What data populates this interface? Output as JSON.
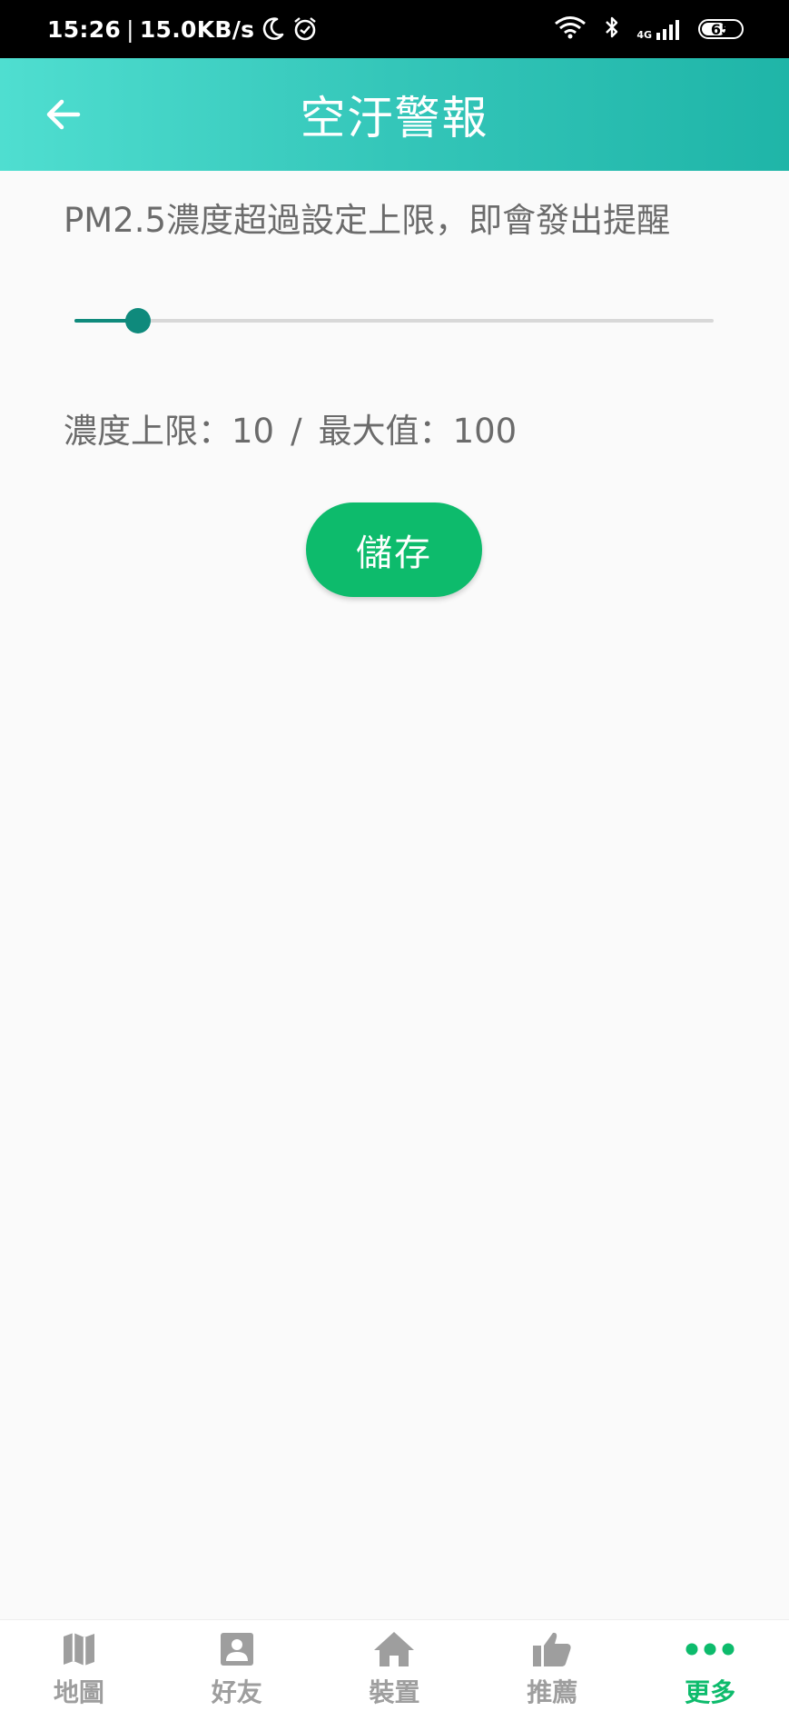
{
  "status_bar": {
    "time": "15:26",
    "speed": "15.0KB/s",
    "battery": "65",
    "battery_level": 0.65,
    "network": "4G"
  },
  "app_bar": {
    "title": "空汙警報"
  },
  "content": {
    "description": "PM2.5濃度超過設定上限，即會發出提醒",
    "limit_label": "濃度上限：",
    "limit_value": "10",
    "separator": "/",
    "max_label": "最大值：",
    "max_value": "100",
    "slider": {
      "value": 10,
      "min": 0,
      "max": 100
    },
    "save_label": "儲存"
  },
  "colors": {
    "accent": "#0f8a7c",
    "save_button": "#0dbb6c",
    "app_bar_start": "#4fded0",
    "app_bar_end": "#1fb5a8",
    "nav_active": "#0dbb6c",
    "nav_inactive": "#9e9e9e"
  },
  "bottom_nav": {
    "items": [
      {
        "label": "地圖",
        "icon": "map-icon",
        "active": false
      },
      {
        "label": "好友",
        "icon": "contact-icon",
        "active": false
      },
      {
        "label": "裝置",
        "icon": "home-icon",
        "active": false
      },
      {
        "label": "推薦",
        "icon": "thumbs-up-icon",
        "active": false
      },
      {
        "label": "更多",
        "icon": "more-dots-icon",
        "active": true
      }
    ]
  }
}
